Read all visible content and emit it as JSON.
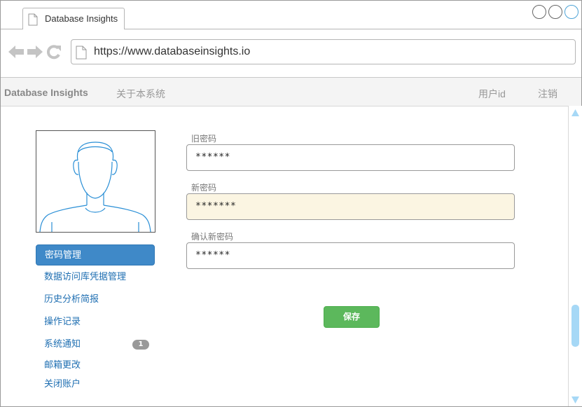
{
  "browser": {
    "tab_title": "Database Insights",
    "url": "https://www.databaseinsights.io"
  },
  "app_nav": {
    "brand": "Database Insights",
    "about": "关于本系统",
    "user_id": "用户id",
    "logout": "注销"
  },
  "sidebar": {
    "items": [
      {
        "label": "密码管理",
        "active": true
      },
      {
        "label": "数据访问库凭据管理"
      },
      {
        "label": "历史分析简报"
      },
      {
        "label": "操作记录"
      },
      {
        "label": "系统通知",
        "badge": "1"
      },
      {
        "label": "邮箱更改"
      },
      {
        "label": "关闭账户"
      }
    ]
  },
  "form": {
    "old_password": {
      "label": "旧密码",
      "value": "******"
    },
    "new_password": {
      "label": "新密码",
      "value": "*******"
    },
    "confirm_password": {
      "label": "确认新密码",
      "value": "******"
    },
    "save_label": "保存"
  },
  "colors": {
    "accent": "#3f89c8",
    "save_button": "#5cb85c",
    "focused_field": "#fbf5e2",
    "scroll_thumb": "#a6d8f6"
  }
}
